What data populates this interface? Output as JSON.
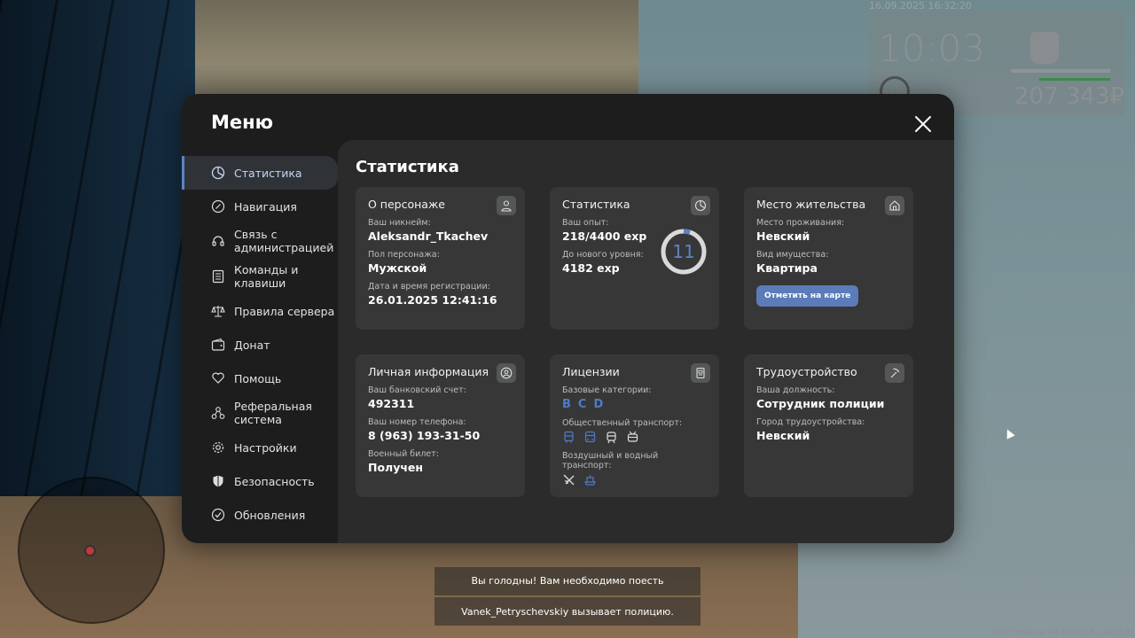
{
  "hud": {
    "datetime": "16.09.2025 16:32:20",
    "time": "10:03",
    "level": "11",
    "exp": "218/4400",
    "money": "207 343₽"
  },
  "menu": {
    "title": "Меню",
    "sidebar": [
      {
        "label": "Статистика",
        "icon": "pie-chart-icon"
      },
      {
        "label": "Навигация",
        "icon": "compass-icon"
      },
      {
        "label": "Связь с администрацией",
        "icon": "headset-icon"
      },
      {
        "label": "Команды и клавиши",
        "icon": "list-icon"
      },
      {
        "label": "Правила сервера",
        "icon": "scales-icon"
      },
      {
        "label": "Донат",
        "icon": "wallet-icon"
      },
      {
        "label": "Помощь",
        "icon": "heart-hand-icon"
      },
      {
        "label": "Реферальная система",
        "icon": "network-icon"
      },
      {
        "label": "Настройки",
        "icon": "gear-icon"
      },
      {
        "label": "Безопасность",
        "icon": "shield-icon"
      },
      {
        "label": "Обновления",
        "icon": "check-circle-icon"
      }
    ]
  },
  "content": {
    "title": "Статистика",
    "character": {
      "heading": "О персонаже",
      "nick_label": "Ваш никнейм:",
      "nick": "Aleksandr_Tkachev",
      "gender_label": "Пол персонажа:",
      "gender": "Мужской",
      "reg_label": "Дата и время регистрации:",
      "reg": "26.01.2025 12:41:16"
    },
    "stats": {
      "heading": "Статистика",
      "exp_label": "Ваш опыт:",
      "exp": "218/4400 exp",
      "next_label": "До нового уровня:",
      "next": "4182 exp",
      "level": "11",
      "progress": 0.05
    },
    "residence": {
      "heading": "Место жительства",
      "place_label": "Место проживания:",
      "place": "Невский",
      "property_label": "Вид имущества:",
      "property": "Квартира",
      "button": "Отметить на карте"
    },
    "personal": {
      "heading": "Личная информация",
      "bank_label": "Ваш банковский счет:",
      "bank": "492311",
      "phone_label": "Ваш номер телефона:",
      "phone": "8 (963) 193-31-50",
      "military_label": "Военный билет:",
      "military": "Получен"
    },
    "licenses": {
      "heading": "Лицензии",
      "base_label": "Базовые категории:",
      "categories": [
        "B",
        "C",
        "D"
      ],
      "public_label": "Общественный транспорт:",
      "public_icons": [
        "bus-icon",
        "coach-icon",
        "tram-icon",
        "trolleybus-icon"
      ],
      "air_label": "Воздушный и водный транспорт:",
      "air_icons": [
        "plane-icon",
        "boat-icon"
      ]
    },
    "employment": {
      "heading": "Трудоустройство",
      "position_label": "Ваша должность:",
      "position": "Сотрудник полиции",
      "city_label": "Город трудоустройства:",
      "city": "Невский"
    }
  },
  "chat": {
    "line1": "Вы голодны! Вам необходимо поесть",
    "line2": "Vanek_Petryschevskiy вызывает полицию."
  },
  "build": "MTA:Province #4 (build: 6.12418.9)"
}
